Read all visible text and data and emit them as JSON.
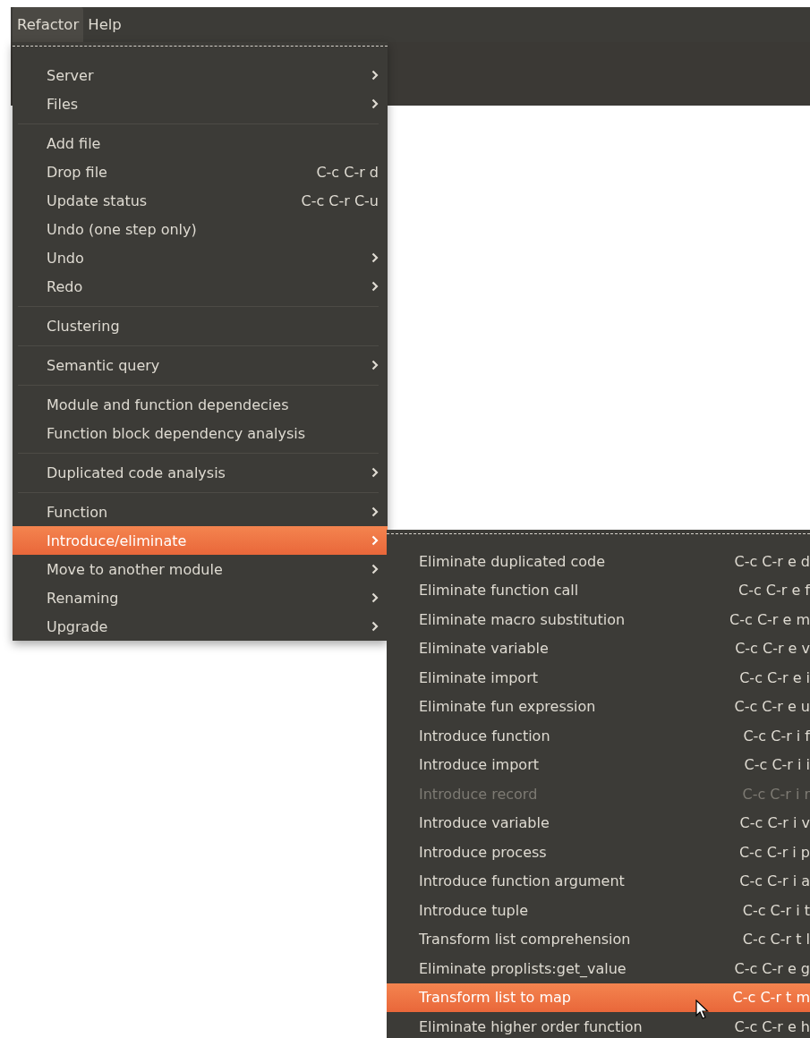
{
  "menubar": [
    {
      "label": "Refactor",
      "selected": true
    },
    {
      "label": "Help",
      "selected": false
    }
  ],
  "menu": {
    "items": [
      {
        "kind": "item",
        "label": "Server",
        "submenu": true,
        "selected": false
      },
      {
        "kind": "item",
        "label": "Files",
        "submenu": true,
        "selected": false
      },
      {
        "kind": "separator"
      },
      {
        "kind": "item",
        "label": "Add file",
        "submenu": false,
        "selected": false
      },
      {
        "kind": "item",
        "label": "Drop file",
        "shortcut": "C-c C-r d",
        "submenu": false,
        "selected": false
      },
      {
        "kind": "item",
        "label": "Update status",
        "shortcut": "C-c C-r C-u",
        "submenu": false,
        "selected": false
      },
      {
        "kind": "item",
        "label": "Undo (one step only)",
        "submenu": false,
        "selected": false
      },
      {
        "kind": "item",
        "label": "Undo",
        "submenu": true,
        "selected": false
      },
      {
        "kind": "item",
        "label": "Redo",
        "submenu": true,
        "selected": false
      },
      {
        "kind": "separator"
      },
      {
        "kind": "item",
        "label": "Clustering",
        "submenu": false,
        "selected": false
      },
      {
        "kind": "separator"
      },
      {
        "kind": "item",
        "label": "Semantic query",
        "submenu": true,
        "selected": false
      },
      {
        "kind": "separator"
      },
      {
        "kind": "item",
        "label": "Module and function dependecies",
        "submenu": false,
        "selected": false
      },
      {
        "kind": "item",
        "label": "Function block dependency analysis",
        "submenu": false,
        "selected": false
      },
      {
        "kind": "separator"
      },
      {
        "kind": "item",
        "label": "Duplicated code analysis",
        "submenu": true,
        "selected": false
      },
      {
        "kind": "separator"
      },
      {
        "kind": "item",
        "label": "Function",
        "submenu": true,
        "selected": false
      },
      {
        "kind": "item",
        "label": "Introduce/eliminate",
        "submenu": true,
        "selected": true
      },
      {
        "kind": "item",
        "label": "Move to another module",
        "submenu": true,
        "selected": false
      },
      {
        "kind": "item",
        "label": "Renaming",
        "submenu": true,
        "selected": false
      },
      {
        "kind": "item",
        "label": "Upgrade",
        "submenu": true,
        "selected": false
      }
    ]
  },
  "submenu": {
    "items": [
      {
        "label": "Eliminate duplicated code",
        "shortcut": "C-c C-r e d",
        "disabled": false,
        "selected": false
      },
      {
        "label": "Eliminate function call",
        "shortcut": "C-c C-r e f",
        "disabled": false,
        "selected": false
      },
      {
        "label": "Eliminate macro substitution",
        "shortcut": "C-c C-r e m",
        "disabled": false,
        "selected": false
      },
      {
        "label": "Eliminate variable",
        "shortcut": "C-c C-r e v",
        "disabled": false,
        "selected": false
      },
      {
        "label": "Eliminate import",
        "shortcut": "C-c C-r e i",
        "disabled": false,
        "selected": false
      },
      {
        "label": "Eliminate fun expression",
        "shortcut": "C-c C-r e u",
        "disabled": false,
        "selected": false
      },
      {
        "label": "Introduce function",
        "shortcut": "C-c C-r i f",
        "disabled": false,
        "selected": false
      },
      {
        "label": "Introduce import",
        "shortcut": "C-c C-r i i",
        "disabled": false,
        "selected": false
      },
      {
        "label": "Introduce record",
        "shortcut": "C-c C-r i r",
        "disabled": true,
        "selected": false
      },
      {
        "label": "Introduce variable",
        "shortcut": "C-c C-r i v",
        "disabled": false,
        "selected": false
      },
      {
        "label": "Introduce process",
        "shortcut": "C-c C-r i p",
        "disabled": false,
        "selected": false
      },
      {
        "label": "Introduce function argument",
        "shortcut": "C-c C-r i a",
        "disabled": false,
        "selected": false
      },
      {
        "label": "Introduce tuple",
        "shortcut": "C-c C-r i t",
        "disabled": false,
        "selected": false
      },
      {
        "label": "Transform list comprehension",
        "shortcut": "C-c C-r t l",
        "disabled": false,
        "selected": false
      },
      {
        "label": "Eliminate proplists:get_value",
        "shortcut": "C-c C-r e g",
        "disabled": false,
        "selected": false
      },
      {
        "label": "Transform list to map",
        "shortcut": "C-c C-r t m",
        "disabled": false,
        "selected": true
      },
      {
        "label": "Eliminate higher order function",
        "shortcut": "C-c C-r e h",
        "disabled": false,
        "selected": false
      }
    ]
  }
}
